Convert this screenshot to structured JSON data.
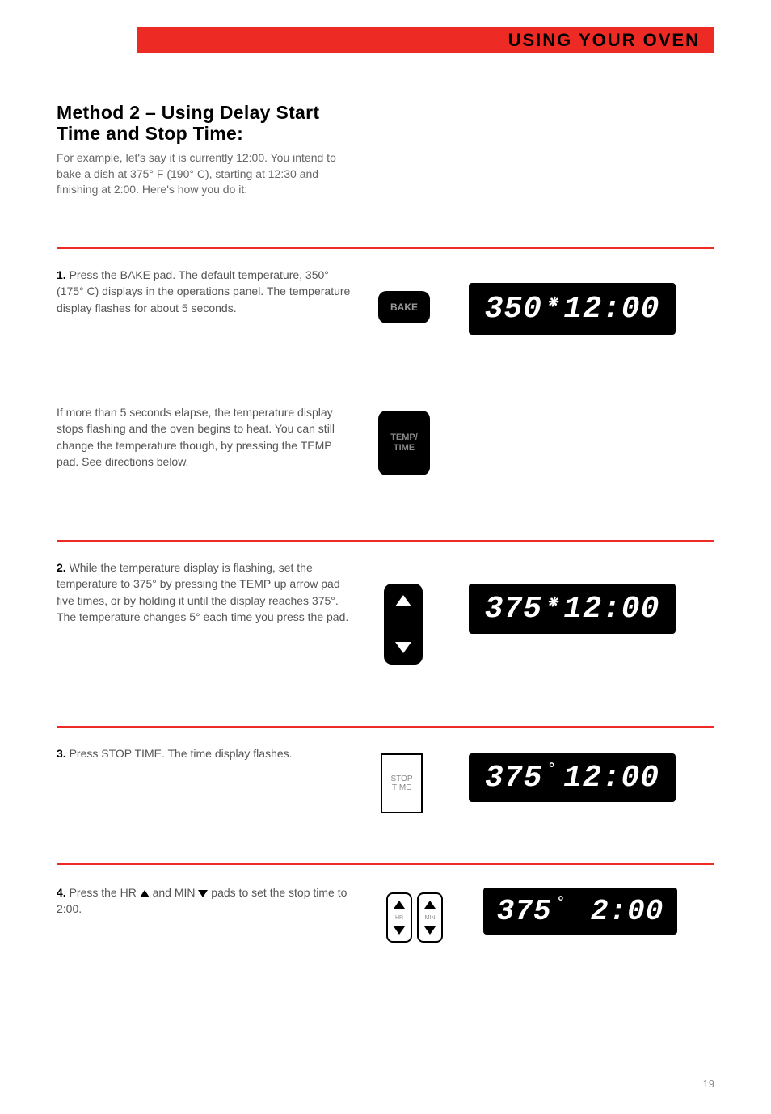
{
  "header": {
    "title": "USING YOUR OVEN"
  },
  "heading": {
    "line1": "Method 2 – Using Delay Start",
    "line2": "Time and Stop Time:"
  },
  "intro": "For example, let's say it is currently 12:00. You intend to bake a dish at 375° F (190° C), starting at 12:30 and finishing at 2:00. Here's how you do it:",
  "steps": {
    "s1a_num": "1.",
    "s1a": " Press the BAKE pad. The default temperature, 350° (175° C) displays in the operations panel. The temperature display flashes for about 5 seconds.",
    "s1b": "If more than 5 seconds elapse, the temperature display stops flashing and the oven begins to heat. You can still change the temperature though, by pressing the TEMP pad. See directions below.",
    "s2_num": "2.",
    "s2": " While the temperature display is flashing, set the temperature to 375° by pressing the TEMP up arrow pad five times, or by holding it until the display reaches 375°. The temperature changes 5° each time you press the pad.",
    "s3_num": "3.",
    "s3": " Press STOP TIME. The time display flashes.",
    "s4_num": "4.",
    "s4_a": " Press the HR ",
    "s4_b": " and MIN ",
    "s4_c": " pads to set the stop time to 2:00."
  },
  "buttons": {
    "bake": "BAKE",
    "temp": "TEMP/\nTIME",
    "stoptime": "STOP\nTIME",
    "hr": "HR",
    "min": "MIN"
  },
  "displays": {
    "d1_temp": "350",
    "d1_time": "12:00",
    "d2_temp": "375",
    "d2_time": "12:00",
    "d3_temp": "375",
    "d3_time": "12:00",
    "d4_temp": "375",
    "d4_time": "2:00"
  },
  "page": "19"
}
